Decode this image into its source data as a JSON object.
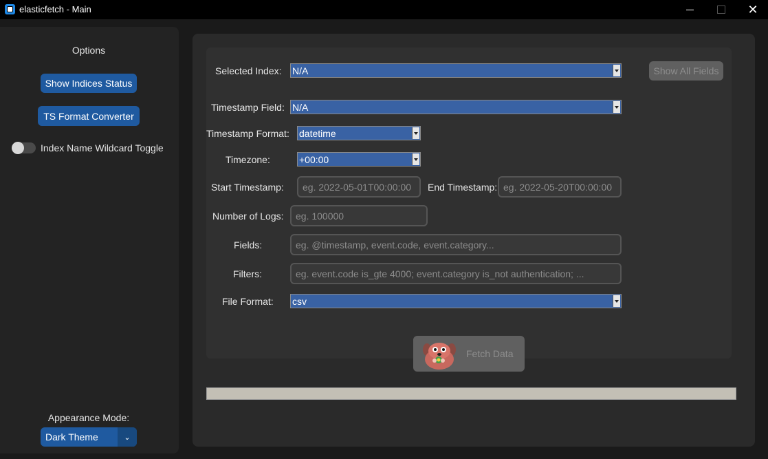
{
  "window": {
    "title": "elasticfetch - Main",
    "controls": {
      "minimize": "",
      "maximize": "",
      "close": "✕"
    }
  },
  "sidebar": {
    "options_label": "Options",
    "show_indices_label": "Show Indices Status",
    "ts_converter_label": "TS Format Converter",
    "wildcard_toggle_label": "Index Name Wildcard Toggle",
    "wildcard_toggle_on": false,
    "appearance_label": "Appearance Mode:",
    "appearance_value": "Dark Theme",
    "appearance_arrow": "⌄"
  },
  "form": {
    "selected_index": {
      "label": "Selected Index:",
      "value": "N/A"
    },
    "show_all_fields_label": "Show All Fields",
    "timestamp_field": {
      "label": "Timestamp Field:",
      "value": "N/A"
    },
    "timestamp_format": {
      "label": "Timestamp Format:",
      "value": "datetime"
    },
    "timezone": {
      "label": "Timezone:",
      "value": "+00:00"
    },
    "start_timestamp": {
      "label": "Start Timestamp:",
      "placeholder": "eg. 2022-05-01T00:00:00"
    },
    "end_timestamp": {
      "label": "End Timestamp:",
      "placeholder": "eg. 2022-05-20T00:00:00"
    },
    "number_of_logs": {
      "label": "Number of Logs:",
      "placeholder": "eg. 100000"
    },
    "fields": {
      "label": "Fields:",
      "placeholder": "eg. @timestamp, event.code, event.category..."
    },
    "filters": {
      "label": "Filters:",
      "placeholder": "eg. event.code is_gte 4000; event.category is_not authentication; ..."
    },
    "file_format": {
      "label": "File Format:",
      "value": "csv"
    }
  },
  "fetch_button_label": "Fetch Data",
  "progress": {
    "value": 0
  },
  "colors": {
    "accent_blue": "#1f5aa0",
    "combo_blue": "#3962a4",
    "disabled_gray": "#606060",
    "progress_track": "#c3bfb5"
  }
}
